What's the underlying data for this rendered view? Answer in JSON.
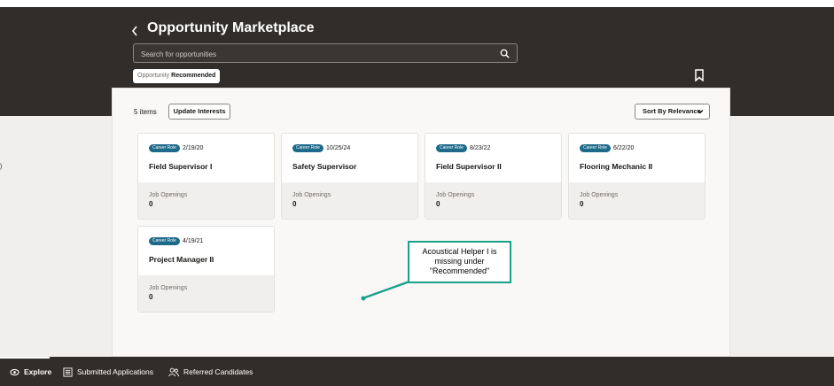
{
  "header": {
    "title": "Opportunity Marketplace",
    "search_placeholder": "Search for opportunities",
    "filter_chip": {
      "label": "Opportunity",
      "value": "Recommended"
    }
  },
  "results": {
    "count_label": "5 items",
    "update_button": "Update Interests",
    "sort_button": "Sort By Relevance"
  },
  "cards": [
    {
      "badge": "Career Role",
      "date": "2/19/20",
      "title": "Field Supervisor I",
      "openings_label": "Job Openings",
      "openings": "0"
    },
    {
      "badge": "Career Role",
      "date": "10/25/24",
      "title": "Safety Supervisor",
      "openings_label": "Job Openings",
      "openings": "0"
    },
    {
      "badge": "Career Role",
      "date": "8/23/22",
      "title": "Field Supervisor II",
      "openings_label": "Job Openings",
      "openings": "0"
    },
    {
      "badge": "Career Role",
      "date": "6/22/20",
      "title": "Flooring Mechanic II",
      "openings_label": "Job Openings",
      "openings": "0"
    },
    {
      "badge": "Career Role",
      "date": "4/19/21",
      "title": "Project Manager II",
      "openings_label": "Job Openings",
      "openings": "0"
    }
  ],
  "annotation": {
    "lines": [
      "Acoustical Helper I is",
      "missing under",
      "\"Recommended\""
    ],
    "border_color": "#1ba088"
  },
  "left_mark": ")",
  "bottom_nav": {
    "items": [
      {
        "label": "Explore",
        "icon": "eye-icon",
        "active": true
      },
      {
        "label": "Submitted Applications",
        "icon": "list-icon",
        "active": false
      },
      {
        "label": "Referred Candidates",
        "icon": "people-icon",
        "active": false
      }
    ]
  },
  "colors": {
    "header_bg": "#312d2a",
    "badge_bg": "#1e6a8a",
    "page_bg": "#f1efed"
  }
}
